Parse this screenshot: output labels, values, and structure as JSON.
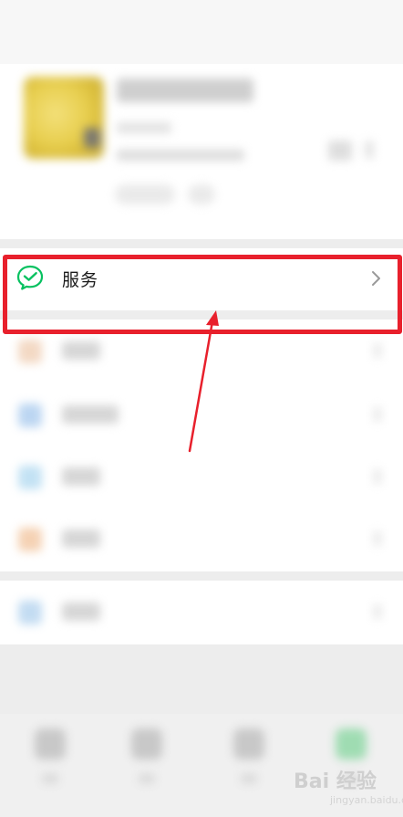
{
  "service": {
    "label": "服务",
    "icon": "wechat-pay-icon"
  },
  "colors": {
    "highlight": "#e8202c",
    "service_icon_green": "#07c160",
    "background": "#ededed"
  },
  "watermark": {
    "text": "Bai 经验",
    "sub": "jingyan.baidu.com"
  }
}
